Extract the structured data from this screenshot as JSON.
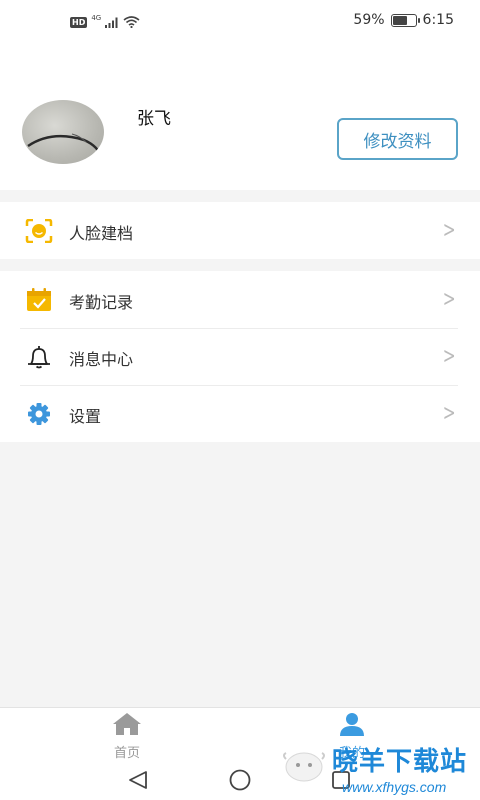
{
  "status_bar": {
    "hd": "HD",
    "network": "4G",
    "battery_text": "59%",
    "battery_level": 0.59,
    "time": "6:15"
  },
  "profile": {
    "name": "张飞",
    "edit_label": "修改资料"
  },
  "menu_groups": [
    [
      {
        "label": "人脸建档",
        "icon": "face-scan-icon"
      }
    ],
    [
      {
        "label": "考勤记录",
        "icon": "calendar-check-icon"
      },
      {
        "label": "消息中心",
        "icon": "bell-icon"
      },
      {
        "label": "设置",
        "icon": "gear-icon"
      }
    ]
  ],
  "tabs": [
    {
      "label": "首页",
      "icon": "home-icon",
      "active": false
    },
    {
      "label": "我的",
      "icon": "user-icon",
      "active": true
    }
  ],
  "watermark": {
    "title": "晓羊下载站",
    "url": "www.xfhygs.com"
  },
  "colors": {
    "accent": "#3d8fc0",
    "tab_active": "#3b9be0",
    "tab_inactive": "#999999",
    "icon_yellow": "#f5b800",
    "icon_blue": "#3d96dc"
  }
}
